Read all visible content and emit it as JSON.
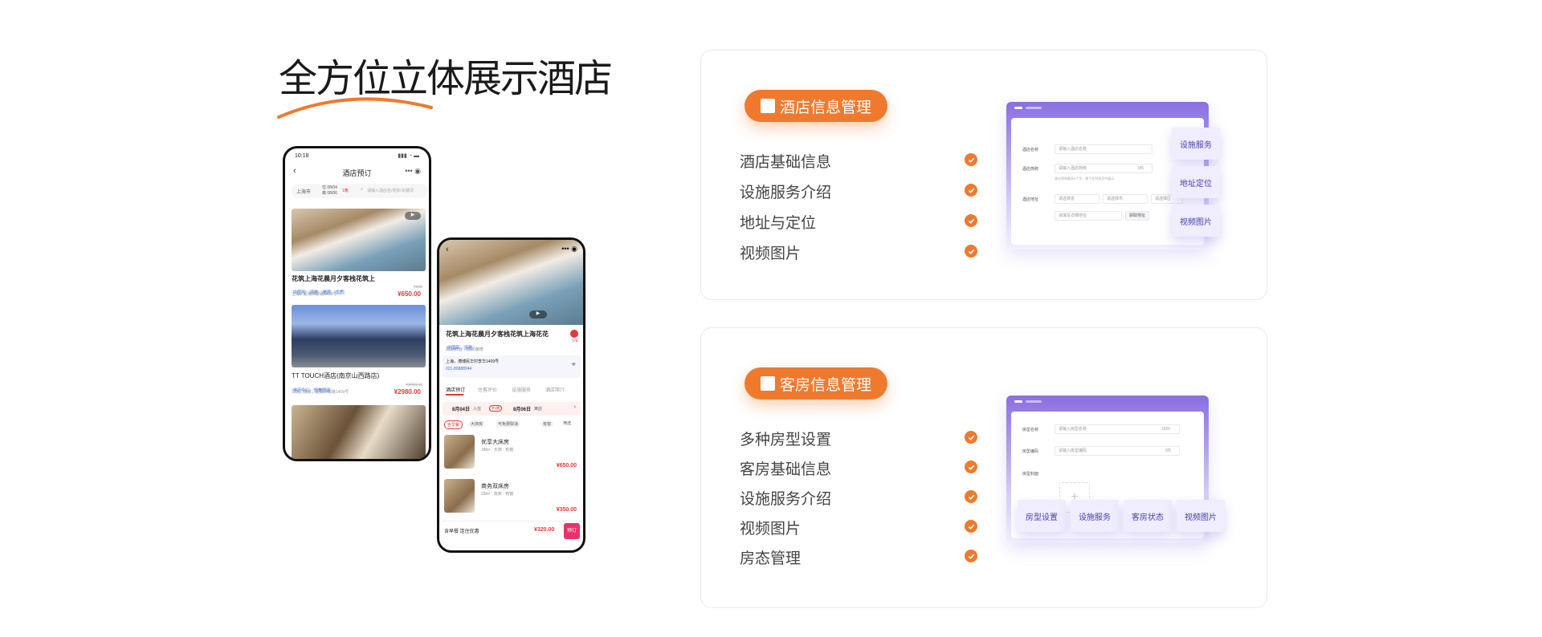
{
  "hero": {
    "title": "全方位立体展示酒店"
  },
  "phone1": {
    "time": "10:18",
    "nav_title": "酒店预订",
    "city": "上海市",
    "date_in": "住 08/04",
    "date_out": "离 08/06",
    "nights": "1晚",
    "search_placeholder": "请输入酒店名/地标/关键词",
    "hotels": [
      {
        "name": "花筑上海花晨月夕客栈花筑上",
        "tags": [
          "中国风",
          "清雅",
          "雅居",
          "优质"
        ],
        "addr": "上海，距离洪泉路1409号",
        "price": "¥650.00",
        "orig": "¥900"
      },
      {
        "name": "TT TOUCH酒店(南京山西路店)",
        "tags": [
          "亲近中心",
          "轻奢舒适"
        ],
        "addr": "江苏，南京，距离洪泉路1409号",
        "price": "¥2980.00",
        "orig": "¥3980.00"
      }
    ]
  },
  "phone2": {
    "hotel_name": "花筑上海花晨月夕客栈花筑上海花花",
    "tags": [
      "中国风",
      "清雅"
    ],
    "opened": "2020开业 · 2020装修",
    "address": "上海，漕博民华村李华1409号",
    "phone": "021-80888944",
    "share": "分享",
    "tabs": [
      "酒店预订",
      "住客评价",
      "设施服务",
      "酒店简介"
    ],
    "date_in": "8月04日",
    "date_in_suffix": "入住",
    "nights": "共1晚",
    "date_out": "8月06日",
    "date_out_suffix": "离店",
    "filters": [
      "含早餐",
      "大床房",
      "可免费取消",
      "有窗",
      "筛选"
    ],
    "rooms": [
      {
        "name": "优享大床房",
        "meta": "18m² · 大床 · 有窗",
        "price": "¥650.00"
      },
      {
        "name": "商务双床房",
        "meta": "23m² · 双床 · 有窗",
        "price": "¥350.00"
      }
    ],
    "promo": "含早餐 连住优惠",
    "promo_price": "¥320.00",
    "book": "预订"
  },
  "card1": {
    "pill": "酒店信息管理",
    "features": [
      "酒店基础信息",
      "设施服务介绍",
      "地址与定位",
      "视频图片"
    ],
    "form": {
      "labels": [
        "酒店名称",
        "酒店简称",
        "酒店地址"
      ],
      "placeholders": [
        "请输入酒店名称",
        "请输入酒店简称",
        "请填写详细地址"
      ],
      "counter": "0/5",
      "hint": "建议简称最多5个字，便于在列表页中展示",
      "selects": [
        "请选择省",
        "请选择市",
        "请选择区"
      ],
      "locate_btn": "获取地址"
    },
    "chips": [
      "设施服务",
      "地址定位",
      "视频图片"
    ]
  },
  "card2": {
    "pill": "客房信息管理",
    "features": [
      "多种房型设置",
      "客房基础信息",
      "设施服务介绍",
      "视频图片",
      "房态管理"
    ],
    "form": {
      "labels": [
        "房型名称",
        "房型编码",
        "房型封面"
      ],
      "placeholders": [
        "请输入房型名称",
        "请输入房型编码"
      ],
      "counters": [
        "0/20",
        "0/5"
      ]
    },
    "chips": [
      "房型设置",
      "设施服务",
      "客房状态",
      "视频图片"
    ]
  },
  "colors": {
    "accent": "#ef7a2e",
    "purple": "#8a6fe0",
    "price": "#e53935"
  }
}
